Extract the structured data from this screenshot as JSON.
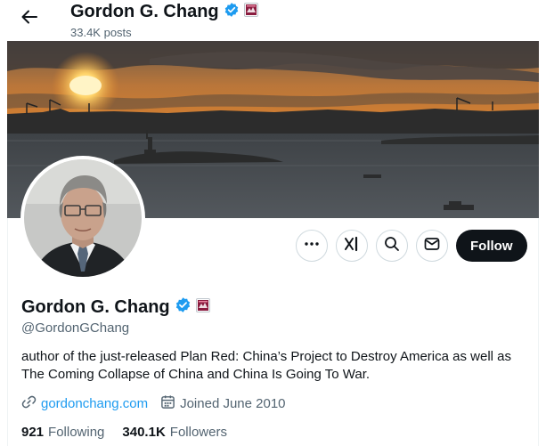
{
  "header": {
    "name": "Gordon G. Chang",
    "posts_count": "33.4K posts"
  },
  "profile": {
    "name": "Gordon G. Chang",
    "handle": "@GordonGChang",
    "bio": "author of the just-released Plan Red: China’s Project to Destroy America as well as The Coming Collapse of China and China Is Going To War.",
    "website": "gordonchang.com",
    "joined": "Joined June 2010",
    "following_count": "921",
    "following_label": "Following",
    "followers_count": "340.1K",
    "followers_label": "Followers"
  },
  "actions": {
    "follow_label": "Follow"
  },
  "icons": {
    "back": "arrow-left-icon",
    "verified": "verified-badge-icon",
    "affiliate": "affiliate-badge-icon",
    "more": "more-horizontal-icon",
    "grok": "grok-icon",
    "search": "search-icon",
    "message": "mail-icon",
    "link": "link-icon",
    "calendar": "calendar-icon"
  },
  "colors": {
    "accent": "#1d9bf0",
    "text_primary": "#0f1419",
    "text_secondary": "#536471",
    "follow_button_bg": "#0f1419"
  }
}
